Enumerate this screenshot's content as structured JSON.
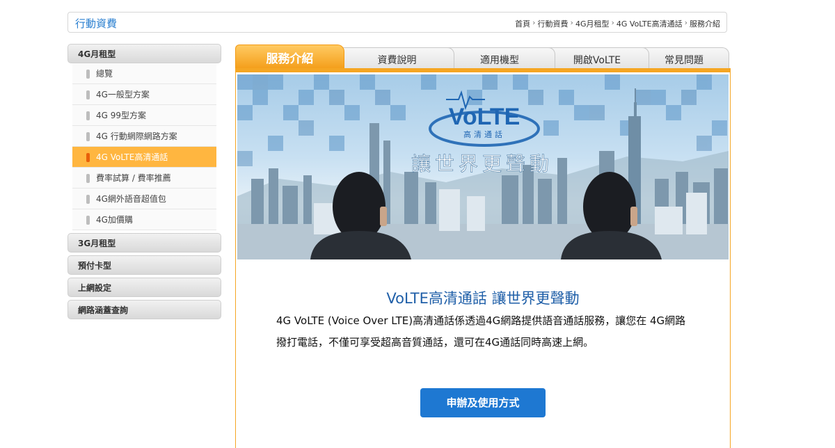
{
  "header": {
    "title": "行動資費",
    "breadcrumbs": [
      "首頁",
      "行動資費",
      "4G月租型",
      "4G VoLTE高清通話",
      "服務介紹"
    ],
    "separator": "›"
  },
  "sidebar": {
    "groups": [
      {
        "label": "4G月租型",
        "items": [
          {
            "label": "總覽"
          },
          {
            "label": "4G一般型方案"
          },
          {
            "label": "4G 99型方案"
          },
          {
            "label": "4G 行動網際網路方案"
          },
          {
            "label": "4G VoLTE高清通話",
            "active": true
          },
          {
            "label": "費率試算 / 費率推薦"
          },
          {
            "label": "4G網外語音超值包"
          },
          {
            "label": "4G加價購"
          }
        ]
      },
      {
        "label": "3G月租型"
      },
      {
        "label": "預付卡型"
      },
      {
        "label": "上網設定"
      },
      {
        "label": "網路涵蓋查詢"
      }
    ]
  },
  "tabs": [
    {
      "label": "服務介紹",
      "active": true
    },
    {
      "label": "資費說明"
    },
    {
      "label": "適用機型"
    },
    {
      "label": "開啟VoLTE"
    },
    {
      "label": "常見問題"
    }
  ],
  "banner": {
    "logo_text": "VoLTE",
    "logo_sub": "高清通話",
    "slogan": "讓世界更聲動"
  },
  "main": {
    "headline": "VoLTE高清通話 讓世界更聲動",
    "description": "4G VoLTE (Voice Over LTE)高清通話係透過4G網路提供語音通話服務，讓您在 4G網路撥打電話，不僅可享受超高音質通話，還可在4G通話同時高速上網。",
    "cta_label": "申辦及使用方式"
  },
  "colors": {
    "accent_orange": "#f5a623",
    "active_item": "#ffb640",
    "brand_blue": "#1e78d2",
    "headline_blue": "#1f5fa8"
  }
}
